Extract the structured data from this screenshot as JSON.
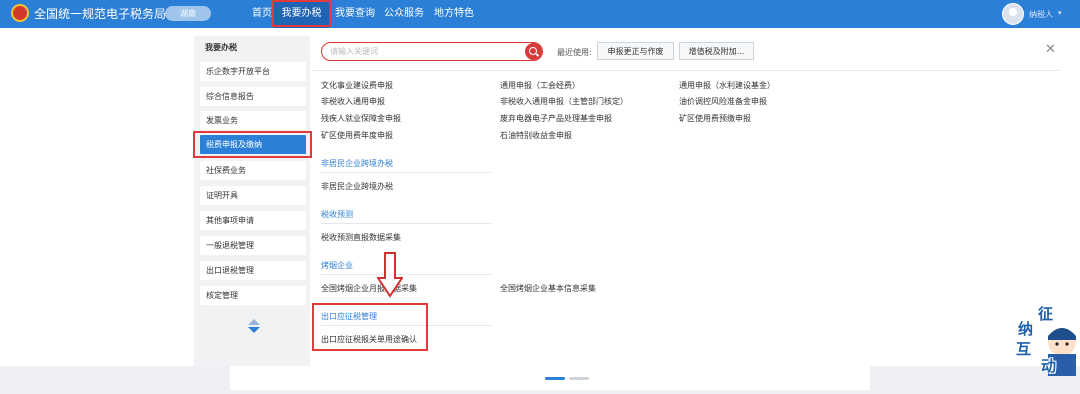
{
  "header": {
    "site_title": "全国统一规范电子税务局",
    "region": "湖南",
    "nav": [
      "首页",
      "我要办税",
      "我要查询",
      "公众服务",
      "地方特色"
    ],
    "user_name": "纳税人"
  },
  "sidebar": {
    "title": "我要办税",
    "items": [
      "乐企数字开放平台",
      "综合信息报告",
      "发票业务",
      "税费申报及缴纳",
      "社保费业务",
      "证明开具",
      "其他事项申请",
      "一般退税管理",
      "出口退税管理",
      "核定管理"
    ],
    "active_index": 3
  },
  "search": {
    "placeholder": "请输入关键词"
  },
  "recent": {
    "label": "最近使用:",
    "items": [
      "申报更正与作废",
      "增值税及附加..."
    ]
  },
  "links": {
    "col1": [
      "文化事业建设费申报",
      "非税收入通用申报",
      "残疾人就业保障金申报",
      "矿区使用费年度申报"
    ],
    "col2": [
      "通用申报（工会经费）",
      "非税收入通用申报（主管部门核定）",
      "废弃电器电子产品处理基金申报",
      "石油特别收益金申报"
    ],
    "col3": [
      "通用申报（水利建设基金）",
      "油价调控风险准备金申报",
      "矿区使用费预缴申报"
    ]
  },
  "sections": [
    {
      "title": "非居民企业跨境办税",
      "items": [
        "非居民企业跨境办税"
      ]
    },
    {
      "title": "税收预测",
      "items": [
        "税收预测直报数据采集"
      ]
    },
    {
      "title": "烤烟企业",
      "items": [
        "全国烤烟企业月报数据采集",
        "全国烤烟企业基本信息采集"
      ]
    },
    {
      "title": "出口应征税管理",
      "items": [
        "出口应征税报关单用途确认"
      ]
    }
  ],
  "watermark": [
    "征",
    "纳",
    "互",
    "动"
  ],
  "colors": {
    "primary": "#2c7fd6",
    "highlight": "#e03a3a"
  }
}
